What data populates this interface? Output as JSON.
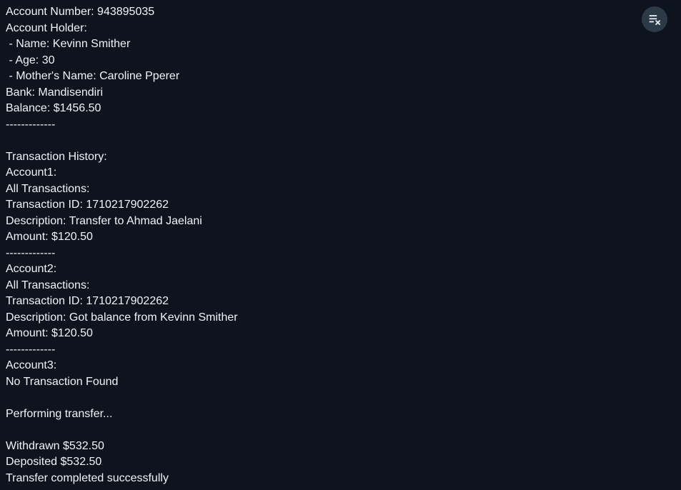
{
  "console": {
    "lines": [
      "Account Number: 943895035",
      "Account Holder:",
      " - Name: Kevinn Smither",
      " - Age: 30",
      " - Mother's Name: Caroline Pperer",
      "Bank: Mandisendiri",
      "Balance: $1456.50",
      "-------------",
      "",
      "Transaction History:",
      "Account1:",
      "All Transactions:",
      "Transaction ID: 1710217902262",
      "Description: Transfer to Ahmad Jaelani",
      "Amount: $120.50",
      "-------------",
      "Account2:",
      "All Transactions:",
      "Transaction ID: 1710217902262",
      "Description: Got balance from Kevinn Smither",
      "Amount: $120.50",
      "-------------",
      "Account3:",
      "No Transaction Found",
      "",
      "Performing transfer...",
      "",
      "Withdrawn $532.50",
      "Deposited $532.50",
      "Transfer completed successfully"
    ]
  },
  "clear_button": {
    "icon": "clear-list-icon"
  },
  "colors": {
    "background": "#0d141d",
    "text": "#f2f4f7",
    "button": "#2c3947",
    "icon": "#e6ebf0"
  }
}
